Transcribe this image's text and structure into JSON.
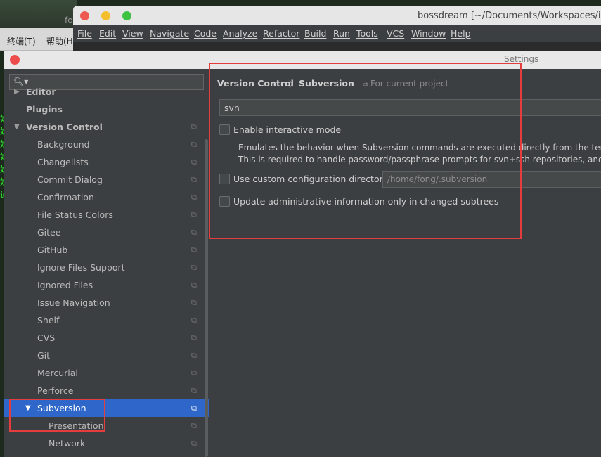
{
  "terminal": {
    "title": "fo",
    "menu": [
      "终端(T)",
      "帮助(H"
    ],
    "glyphs": [
      "妓",
      "妓",
      "妓",
      "妓",
      "妓",
      "妓",
      "迠"
    ]
  },
  "ide": {
    "title": "bossdream [~/Documents/Workspaces/idea/bo",
    "menu": [
      "File",
      "Edit",
      "View",
      "Navigate",
      "Code",
      "Analyze",
      "Refactor",
      "Build",
      "Run",
      "Tools",
      "VCS",
      "Window",
      "Help"
    ]
  },
  "dialog": {
    "title": "Settings"
  },
  "sidebar": {
    "search_placeholder": "",
    "items": [
      {
        "label": "Editor",
        "level": 0,
        "arrow": "▶",
        "bold": true
      },
      {
        "label": "Plugins",
        "level": 0,
        "bold": true
      },
      {
        "label": "Version Control",
        "level": 0,
        "arrow": "▼",
        "bold": true,
        "copy": true
      },
      {
        "label": "Background",
        "level": 1,
        "copy": true
      },
      {
        "label": "Changelists",
        "level": 1,
        "copy": true
      },
      {
        "label": "Commit Dialog",
        "level": 1,
        "copy": true
      },
      {
        "label": "Confirmation",
        "level": 1,
        "copy": true
      },
      {
        "label": "File Status Colors",
        "level": 1,
        "copy": true
      },
      {
        "label": "Gitee",
        "level": 1,
        "copy": true
      },
      {
        "label": "GitHub",
        "level": 1,
        "copy": true
      },
      {
        "label": "Ignore Files Support",
        "level": 1,
        "copy": true
      },
      {
        "label": "Ignored Files",
        "level": 1,
        "copy": true
      },
      {
        "label": "Issue Navigation",
        "level": 1,
        "copy": true
      },
      {
        "label": "Shelf",
        "level": 1,
        "copy": true
      },
      {
        "label": "CVS",
        "level": 1,
        "copy": true
      },
      {
        "label": "Git",
        "level": 1,
        "copy": true
      },
      {
        "label": "Mercurial",
        "level": 1,
        "copy": true
      },
      {
        "label": "Perforce",
        "level": 1,
        "copy": true
      },
      {
        "label": "Subversion",
        "level": 1,
        "arrow": "▼",
        "selected": true,
        "copy": true
      },
      {
        "label": "Presentation",
        "level": 2,
        "copy": true
      },
      {
        "label": "Network",
        "level": 2,
        "copy": true
      }
    ]
  },
  "main": {
    "breadcrumb": [
      "Version Control",
      "Subversion"
    ],
    "breadcrumb_sep": "〉",
    "scope": "For current project",
    "executable_value": "svn",
    "interactive_mode_label": "Enable interactive mode",
    "interactive_desc_1": "Emulates the behavior when Subversion commands are executed directly from the terminal (",
    "interactive_desc_2": "This is required to handle password/passphrase prompts for svn+ssh repositories, and trust i",
    "custom_config_label": "Use custom configuration directory:",
    "custom_config_value": "/home/fong/.subversion",
    "update_admin_label": "Update administrative information only in changed subtrees"
  },
  "colors": {
    "selection": "#2e67c9",
    "annotation": "#e53d3d",
    "panel_bg": "#3c3f41"
  }
}
